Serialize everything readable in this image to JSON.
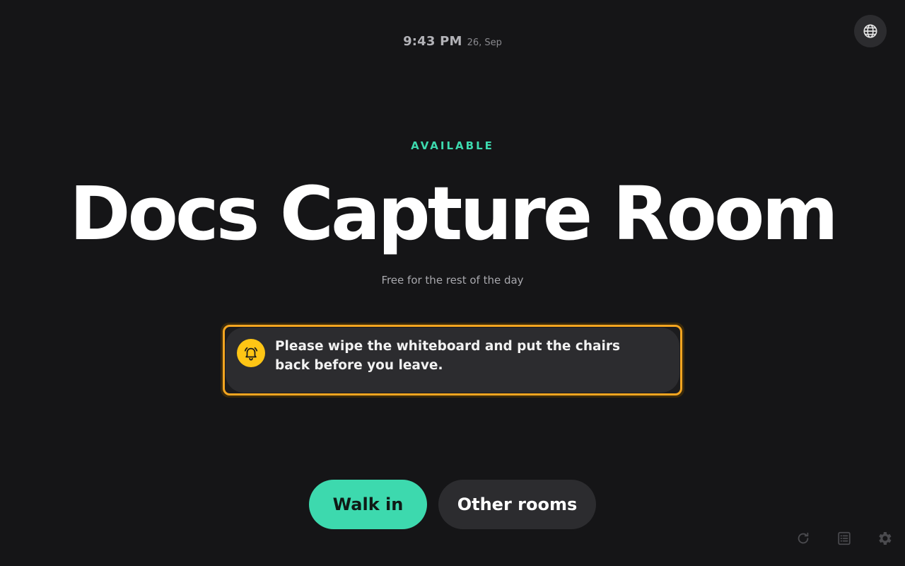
{
  "clock": {
    "time": "9:43 PM",
    "date": "26, Sep"
  },
  "header": {
    "language_icon": "globe-icon"
  },
  "room": {
    "status": "AVAILABLE",
    "name": "Docs Capture Room",
    "subtitle": "Free for the rest of the day"
  },
  "notice": {
    "icon": "bell-icon",
    "text": "Please wipe the whiteboard and put the chairs back before you leave."
  },
  "actions": {
    "walk_in_label": "Walk in",
    "other_rooms_label": "Other rooms"
  },
  "toolbar": {
    "refresh_icon": "refresh-icon",
    "list_icon": "list-icon",
    "settings_icon": "gear-icon"
  },
  "colors": {
    "background": "#151517",
    "accent_green": "#3dd9ae",
    "notice_border": "#f5a520",
    "bell_bg": "#fec515",
    "button_dark": "#2c2c2f"
  }
}
